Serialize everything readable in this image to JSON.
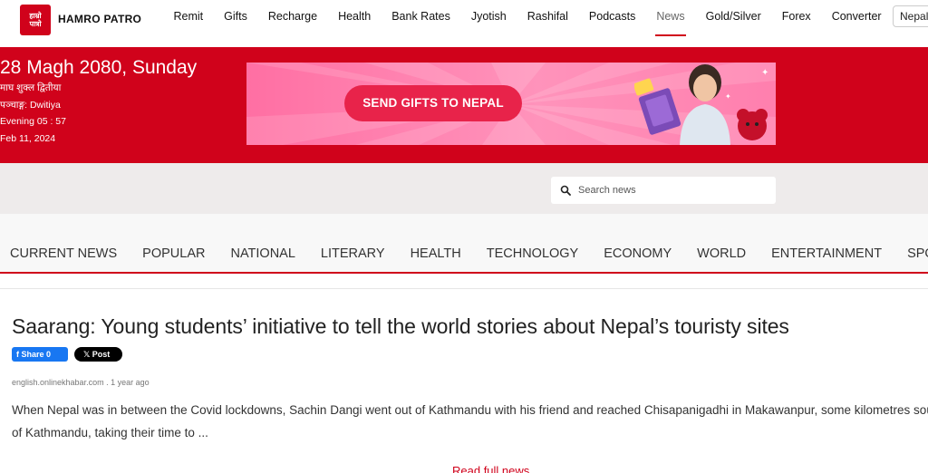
{
  "brand": {
    "logo_text_line1": "हाम्रो",
    "logo_text_line2": "पात्रो",
    "name": "HAMRO PATRO"
  },
  "nav": {
    "items": [
      {
        "label": "Remit"
      },
      {
        "label": "Gifts"
      },
      {
        "label": "Recharge"
      },
      {
        "label": "Health"
      },
      {
        "label": "Bank Rates"
      },
      {
        "label": "Jyotish"
      },
      {
        "label": "Rashifal"
      },
      {
        "label": "Podcasts"
      },
      {
        "label": "News",
        "active": true
      },
      {
        "label": "Gold/Silver"
      },
      {
        "label": "Forex"
      },
      {
        "label": "Converter"
      }
    ],
    "language_button": "Nepali"
  },
  "date_panel": {
    "main": "28 Magh 2080, Sunday",
    "tithi": "माघ शुक्ल द्वितीया",
    "panchang": "पञ्चाङ्ग: Dwitiya",
    "time": "Evening 05 : 57",
    "gregorian": "Feb 11, 2024"
  },
  "ad": {
    "cta": "SEND GIFTS TO NEPAL"
  },
  "search": {
    "placeholder": "Search news"
  },
  "categories": [
    "CURRENT NEWS",
    "POPULAR",
    "NATIONAL",
    "LITERARY",
    "HEALTH",
    "TECHNOLOGY",
    "ECONOMY",
    "WORLD",
    "ENTERTAINMENT",
    "SPORTS"
  ],
  "article": {
    "headline": "Saarang: Young students’ initiative to tell the world stories about Nepal’s touristy sites",
    "share_label": "Share 0",
    "post_label": "Post",
    "source": "english.onlinekhabar.com . 1 year ago",
    "summary": "When Nepal was in between the Covid lockdowns, Sachin Dangi went out of Kathmandu with his friend and reached Chisapanigadhi in Makawanpur, some kilometres south of Kathmandu, taking their time to ...",
    "read_more": "Read full news"
  },
  "colors": {
    "brand_red": "#d0021b",
    "ad_pink": "#ff7fae",
    "facebook_blue": "#1877f2"
  }
}
